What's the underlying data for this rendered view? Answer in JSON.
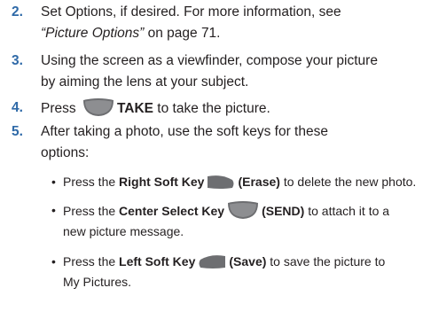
{
  "steps": [
    {
      "number": "2.",
      "line1_a": "Set Options, if desired. For more information, see",
      "line2_ref": "“Picture Options”",
      "line2_b": " on page 71."
    },
    {
      "number": "3.",
      "line1": "Using the screen as a viewfinder, compose your picture",
      "line2": "by aiming the lens at your subject."
    },
    {
      "number": "4.",
      "before": "Press ",
      "key_label": "TAKE",
      "after": " to take the picture."
    },
    {
      "number": "5.",
      "line1": "After taking a photo, use the soft keys for these",
      "line2": "options:"
    }
  ],
  "bullets": [
    {
      "dot": "•",
      "a": "Press the ",
      "key_name": "Right Soft Key",
      "action": "(Erase)",
      "b": " to delete the new photo.",
      "icon": "right-soft-key-icon"
    },
    {
      "dot": "•",
      "a": "Press the ",
      "key_name": "Center Select Key",
      "action": "(SEND)",
      "b": " to attach it to a",
      "line2": "new picture message.",
      "icon": "center-select-key-icon"
    },
    {
      "dot": "•",
      "a": "Press the ",
      "key_name": "Left Soft Key",
      "action": "(Save)",
      "b": " to save the picture to",
      "line2": "My Pictures.",
      "icon": "left-soft-key-icon"
    }
  ],
  "colors": {
    "step_number": "#2f6aa8",
    "key_fill": "#6d6e71",
    "text": "#231f20"
  }
}
